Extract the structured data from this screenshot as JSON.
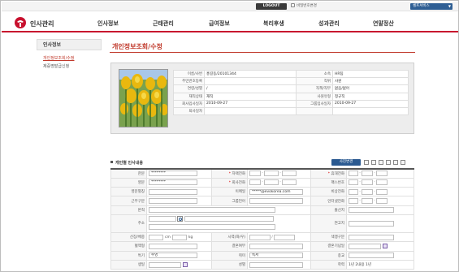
{
  "topbar": {
    "logout_label": "LOGOUT",
    "password_change_label": "비밀번호변경",
    "service_select_label": "셀프서비스"
  },
  "header": {
    "app_title": "인사관리",
    "nav": [
      "인사정보",
      "근태관리",
      "급여정보",
      "복리후생",
      "성과관리",
      "연말정산"
    ]
  },
  "sidebar": {
    "title": "인사정보",
    "items": [
      "개인정보조회/수정",
      "제증명발급신청"
    ]
  },
  "page": {
    "title": "개인정보조회/수정"
  },
  "profile": {
    "rows": [
      {
        "label": "이름/사번",
        "value": "홍길동/20101344",
        "label2": "소속",
        "value2": "HR팀"
      },
      {
        "label": "주민번호등록",
        "value": "",
        "label2": "직위",
        "value2": "사원"
      },
      {
        "label": "연령/성별",
        "value": "/",
        "label2": "직책/직무",
        "value2": "없음/없어"
      },
      {
        "label": "재직상태",
        "value": "재직",
        "label2": "사원유형",
        "value2": "정규직"
      },
      {
        "label": "회사입사일자",
        "value": "2010-09-27",
        "label2": "그룹입사일자",
        "value2": "2010-09-27"
      },
      {
        "label": "퇴사일자",
        "value": "",
        "label2": "",
        "value2": ""
      }
    ]
  },
  "section": {
    "title": "개인별 인사내용",
    "photo_button": "사진변경"
  },
  "form": {
    "l_hanmun": "한문",
    "l_eng": "영문",
    "l_eng_name": "영문별칭",
    "l_work_type": "근무구분",
    "l_origin": "본적",
    "l_address": "주소",
    "l_height_weight": "신장/체중",
    "l_blood": "혈액형",
    "l_hobby": "특기",
    "l_birth": "생일",
    "l_home_phone": "자택전화",
    "l_office_phone": "회사전화",
    "l_email": "이메일",
    "l_group_language": "그룹언어",
    "l_sight": "시력(좌/우)",
    "l_marriage": "결혼여부",
    "l_hobby2": "취미",
    "l_gender": "성별",
    "l_mobile": "휴대전화",
    "l_fax": "팩스번호",
    "l_emergency": "비상전화",
    "l_intranet": "인터넷전화",
    "l_birthplace": "출신지",
    "l_contact": "연고지",
    "l_color_blind": "색맹구분",
    "l_wedding_date": "결혼기념일",
    "l_religion": "종교",
    "l_education": "학력",
    "v_hanmun": "********",
    "v_eng": "********",
    "v_email": "*****@evokorea.com",
    "unit_cm": "cm",
    "unit_kg": "kg",
    "slash": "/",
    "v_hobby": "수영",
    "v_hobby2": "독서",
    "v_education": "1년 2내용 1년",
    "dash": "-"
  }
}
